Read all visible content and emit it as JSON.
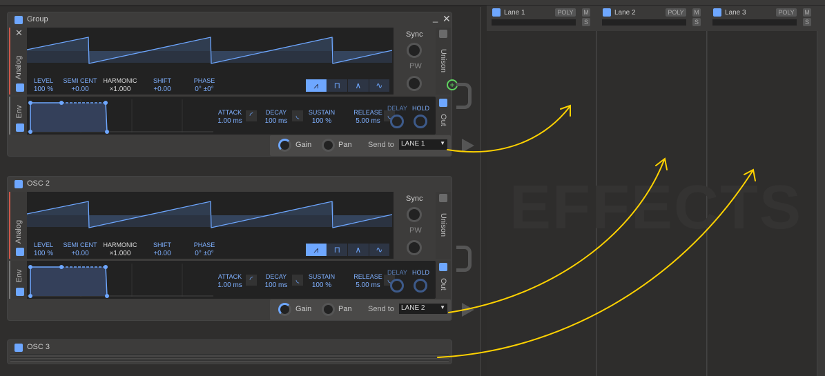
{
  "panels": [
    {
      "title": "Group",
      "osc_label": "Analog",
      "env_label": "Env",
      "params": [
        {
          "label": "LEVEL",
          "value": "100 %"
        },
        {
          "label": "SEMI CENT",
          "value": "+0.00"
        },
        {
          "label": "HARMONIC",
          "value": "×1.000"
        },
        {
          "label": "SHIFT",
          "value": "+0.00"
        },
        {
          "label": "PHASE",
          "value": "0° ±0°"
        }
      ],
      "sync": "Sync",
      "pw": "PW",
      "unison": "Unison",
      "out": "Out",
      "env": [
        {
          "label": "ATTACK",
          "value": "1.00 ms"
        },
        {
          "label": "DECAY",
          "value": "100 ms"
        },
        {
          "label": "SUSTAIN",
          "value": "100 %"
        },
        {
          "label": "RELEASE",
          "value": "5.00 ms"
        }
      ],
      "delay": "DELAY",
      "hold": "HOLD",
      "gain": "Gain",
      "pan": "Pan",
      "send_to": "Send to",
      "send_value": "LANE 1",
      "waveform_selected": "saw"
    },
    {
      "title": "OSC 2",
      "osc_label": "Analog",
      "env_label": "Env",
      "params": [
        {
          "label": "LEVEL",
          "value": "100 %"
        },
        {
          "label": "SEMI CENT",
          "value": "+0.00"
        },
        {
          "label": "HARMONIC",
          "value": "×1.000"
        },
        {
          "label": "SHIFT",
          "value": "+0.00"
        },
        {
          "label": "PHASE",
          "value": "0° ±0°"
        }
      ],
      "sync": "Sync",
      "pw": "PW",
      "unison": "Unison",
      "out": "Out",
      "env": [
        {
          "label": "ATTACK",
          "value": "1.00 ms"
        },
        {
          "label": "DECAY",
          "value": "100 ms"
        },
        {
          "label": "SUSTAIN",
          "value": "100 %"
        },
        {
          "label": "RELEASE",
          "value": "5.00 ms"
        }
      ],
      "delay": "DELAY",
      "hold": "HOLD",
      "gain": "Gain",
      "pan": "Pan",
      "send_to": "Send to",
      "send_value": "LANE 2",
      "waveform_selected": "saw"
    }
  ],
  "osc3": {
    "title": "OSC 3"
  },
  "lanes": [
    {
      "name": "Lane 1",
      "poly": "POLY",
      "m": "M",
      "s": "S"
    },
    {
      "name": "Lane 2",
      "poly": "POLY",
      "m": "M",
      "s": "S"
    },
    {
      "name": "Lane 3",
      "poly": "POLY",
      "m": "M",
      "s": "S"
    }
  ],
  "effects_watermark": "EFFECTS",
  "colors": {
    "accent": "#6ea7ff",
    "annotation": "#ffd200",
    "add": "#5fd35f"
  }
}
